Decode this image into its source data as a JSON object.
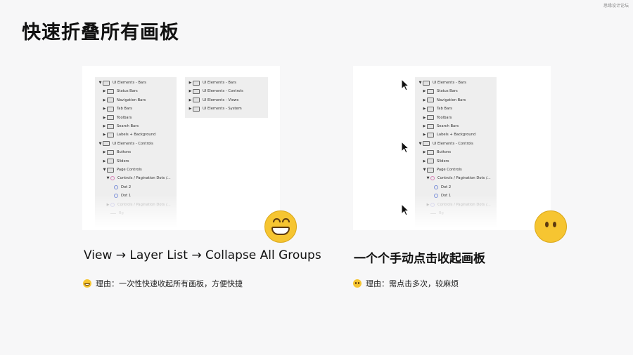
{
  "watermark": "思缘设计论坛",
  "title": "快速折叠所有画板",
  "left": {
    "caption": "View → Layer List → Collapse All Groups",
    "reason": "理由：一次性快速收起所有画板，方便快捷",
    "emoji": "grinning-face",
    "expanded": [
      {
        "label": "UI Elements - Bars",
        "level": 0,
        "toggle": "▼",
        "kind": "folder",
        "dim": false
      },
      {
        "label": "Status Bars",
        "level": 1,
        "toggle": "▶",
        "kind": "folder",
        "dim": false
      },
      {
        "label": "Navigation Bars",
        "level": 1,
        "toggle": "▶",
        "kind": "folder",
        "dim": false
      },
      {
        "label": "Tab Bars",
        "level": 1,
        "toggle": "▶",
        "kind": "folder",
        "dim": false
      },
      {
        "label": "Toolbars",
        "level": 1,
        "toggle": "▶",
        "kind": "folder",
        "dim": false
      },
      {
        "label": "Search Bars",
        "level": 1,
        "toggle": "▶",
        "kind": "folder",
        "dim": false
      },
      {
        "label": "Labels + Background",
        "level": 1,
        "toggle": "▶",
        "kind": "folder",
        "dim": false
      },
      {
        "label": "UI Elements - Controls",
        "level": 0,
        "toggle": "▼",
        "kind": "folder",
        "dim": false
      },
      {
        "label": "Buttons",
        "level": 1,
        "toggle": "▶",
        "kind": "folder",
        "dim": false
      },
      {
        "label": "Sliders",
        "level": 1,
        "toggle": "▶",
        "kind": "folder",
        "dim": false
      },
      {
        "label": "Page Controls",
        "level": 1,
        "toggle": "▼",
        "kind": "folder",
        "dim": false
      },
      {
        "label": "Controls / Pagination Dots /...",
        "level": 2,
        "toggle": "▼",
        "kind": "symbol-pink",
        "dim": false
      },
      {
        "label": "Dot 2",
        "level": 3,
        "toggle": "",
        "kind": "symbol",
        "dim": false
      },
      {
        "label": "Dot 1",
        "level": 3,
        "toggle": "",
        "kind": "symbol",
        "dim": false
      },
      {
        "label": "Controls / Pagination Dots /...",
        "level": 2,
        "toggle": "▶",
        "kind": "symbol-faint",
        "dim": true
      },
      {
        "label": "Bg",
        "level": 2,
        "toggle": "",
        "kind": "line",
        "dim": true
      }
    ],
    "collapsed": [
      {
        "label": "UI Elements - Bars",
        "level": 0,
        "toggle": "▶",
        "kind": "folder",
        "dim": false
      },
      {
        "label": "UI Elements - Controls",
        "level": 0,
        "toggle": "▶",
        "kind": "folder",
        "dim": false
      },
      {
        "label": "UI Elements - Views",
        "level": 0,
        "toggle": "▶",
        "kind": "folder",
        "dim": false
      },
      {
        "label": "UI Elements - System",
        "level": 0,
        "toggle": "▶",
        "kind": "folder",
        "dim": false
      }
    ]
  },
  "right": {
    "caption": "一个个手动点击收起画板",
    "reason": "理由：需点击多次，较麻烦",
    "emoji": "face-without-mouth",
    "cursors": [
      "cursor-arrow",
      "cursor-arrow",
      "cursor-arrow"
    ]
  },
  "colors": {
    "background": "#f7f7f8",
    "card": "#ffffff",
    "panel": "#eeeeee",
    "emoji": "#f6c531"
  }
}
